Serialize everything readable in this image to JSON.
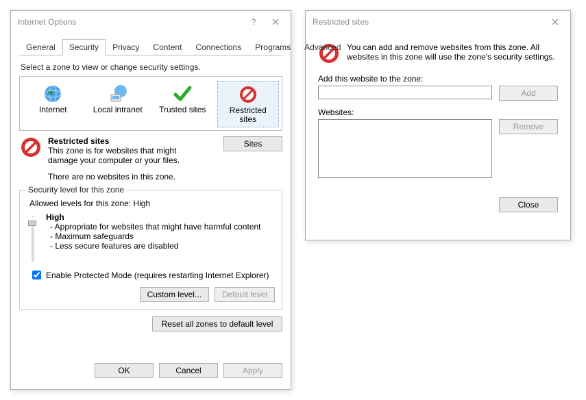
{
  "internetOptions": {
    "title": "Internet Options",
    "tabs": [
      "General",
      "Security",
      "Privacy",
      "Content",
      "Connections",
      "Programs",
      "Advanced"
    ],
    "activeTab": 1,
    "intro": "Select a zone to view or change security settings.",
    "zones": {
      "internet": "Internet",
      "intranet": "Local intranet",
      "trusted": "Trusted sites",
      "restricted_l1": "Restricted",
      "restricted_l2": "sites"
    },
    "desc": {
      "title": "Restricted sites",
      "line1": "This zone is for websites that might",
      "line2": "damage your computer or your files.",
      "empty": "There are no websites in this zone."
    },
    "sitesBtn": "Sites",
    "level": {
      "legend": "Security level for this zone",
      "allowed": "Allowed levels for this zone: High",
      "name": "High",
      "d1": "- Appropriate for websites that might have harmful content",
      "d2": "- Maximum safeguards",
      "d3": "- Less secure features are disabled"
    },
    "protected": "Enable Protected Mode (requires restarting Internet Explorer)",
    "customBtn": "Custom level...",
    "defaultBtn": "Default level",
    "resetBtn": "Reset all zones to default level",
    "ok": "OK",
    "cancel": "Cancel",
    "apply": "Apply"
  },
  "restrictedSites": {
    "title": "Restricted sites",
    "intro": "You can add and remove websites from this zone. All websites in this zone will use the zone's security settings.",
    "addLabel": "Add this website to the zone:",
    "addBtn": "Add",
    "websitesLabel": "Websites:",
    "removeBtn": "Remove",
    "closeBtn": "Close"
  }
}
